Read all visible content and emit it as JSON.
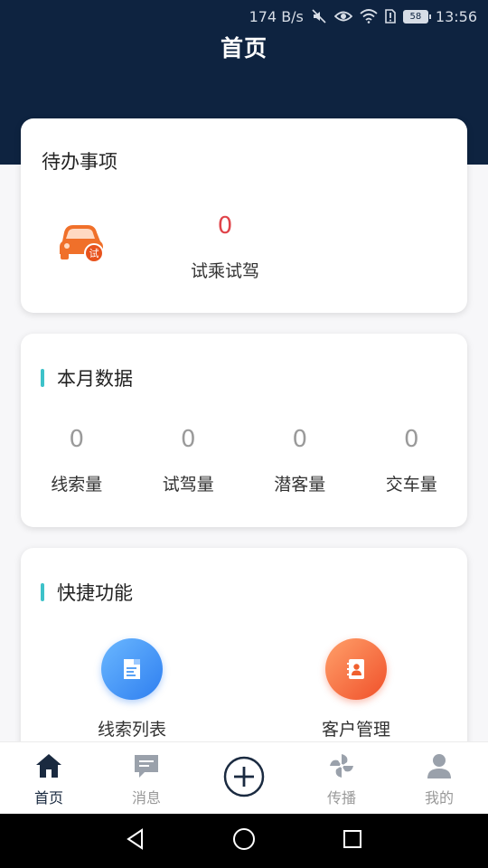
{
  "status_bar": {
    "net_speed": "174 B/s",
    "battery": "58",
    "time": "13:56",
    "icons": [
      "mute-icon",
      "eye-icon",
      "wifi-icon",
      "sim-alert-icon",
      "battery-icon"
    ]
  },
  "header": {
    "title": "首页"
  },
  "todo": {
    "title": "待办事项",
    "count": "0",
    "label": "试乘试驾",
    "icon": "car-test-drive-icon",
    "badge": "试"
  },
  "month": {
    "title": "本月数据",
    "stats": [
      {
        "value": "0",
        "label": "线索量"
      },
      {
        "value": "0",
        "label": "试驾量"
      },
      {
        "value": "0",
        "label": "潜客量"
      },
      {
        "value": "0",
        "label": "交车量"
      }
    ]
  },
  "quick": {
    "title": "快捷功能",
    "items": [
      {
        "label": "线索列表",
        "icon": "lead-list-icon"
      },
      {
        "label": "客户管理",
        "icon": "customer-contacts-icon"
      }
    ]
  },
  "tabbar": {
    "tabs": [
      {
        "label": "首页",
        "icon": "home-icon"
      },
      {
        "label": "消息",
        "icon": "message-icon"
      },
      {
        "label": "传播",
        "icon": "pinwheel-icon"
      },
      {
        "label": "我的",
        "icon": "user-icon"
      }
    ],
    "add_icon": "add-circle-icon"
  },
  "colors": {
    "header_bg": "#0e2340",
    "accent_teal": "#3dc2c9",
    "count_red": "#e0444a",
    "orange": "#f0702a",
    "blue": "#2f7ff0"
  }
}
